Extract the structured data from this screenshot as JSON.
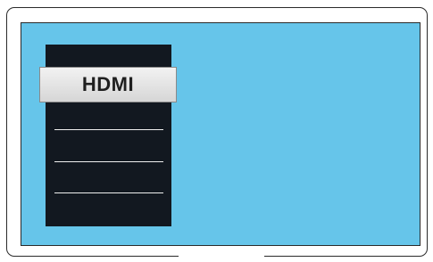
{
  "menu": {
    "selected_label": "HDMI",
    "other_items_count_visible": 3
  },
  "colors": {
    "screen_background": "#66c5ea",
    "menu_background": "#121820",
    "selected_item_background": "#e5e5e5",
    "divider": "#f0f0f0"
  }
}
